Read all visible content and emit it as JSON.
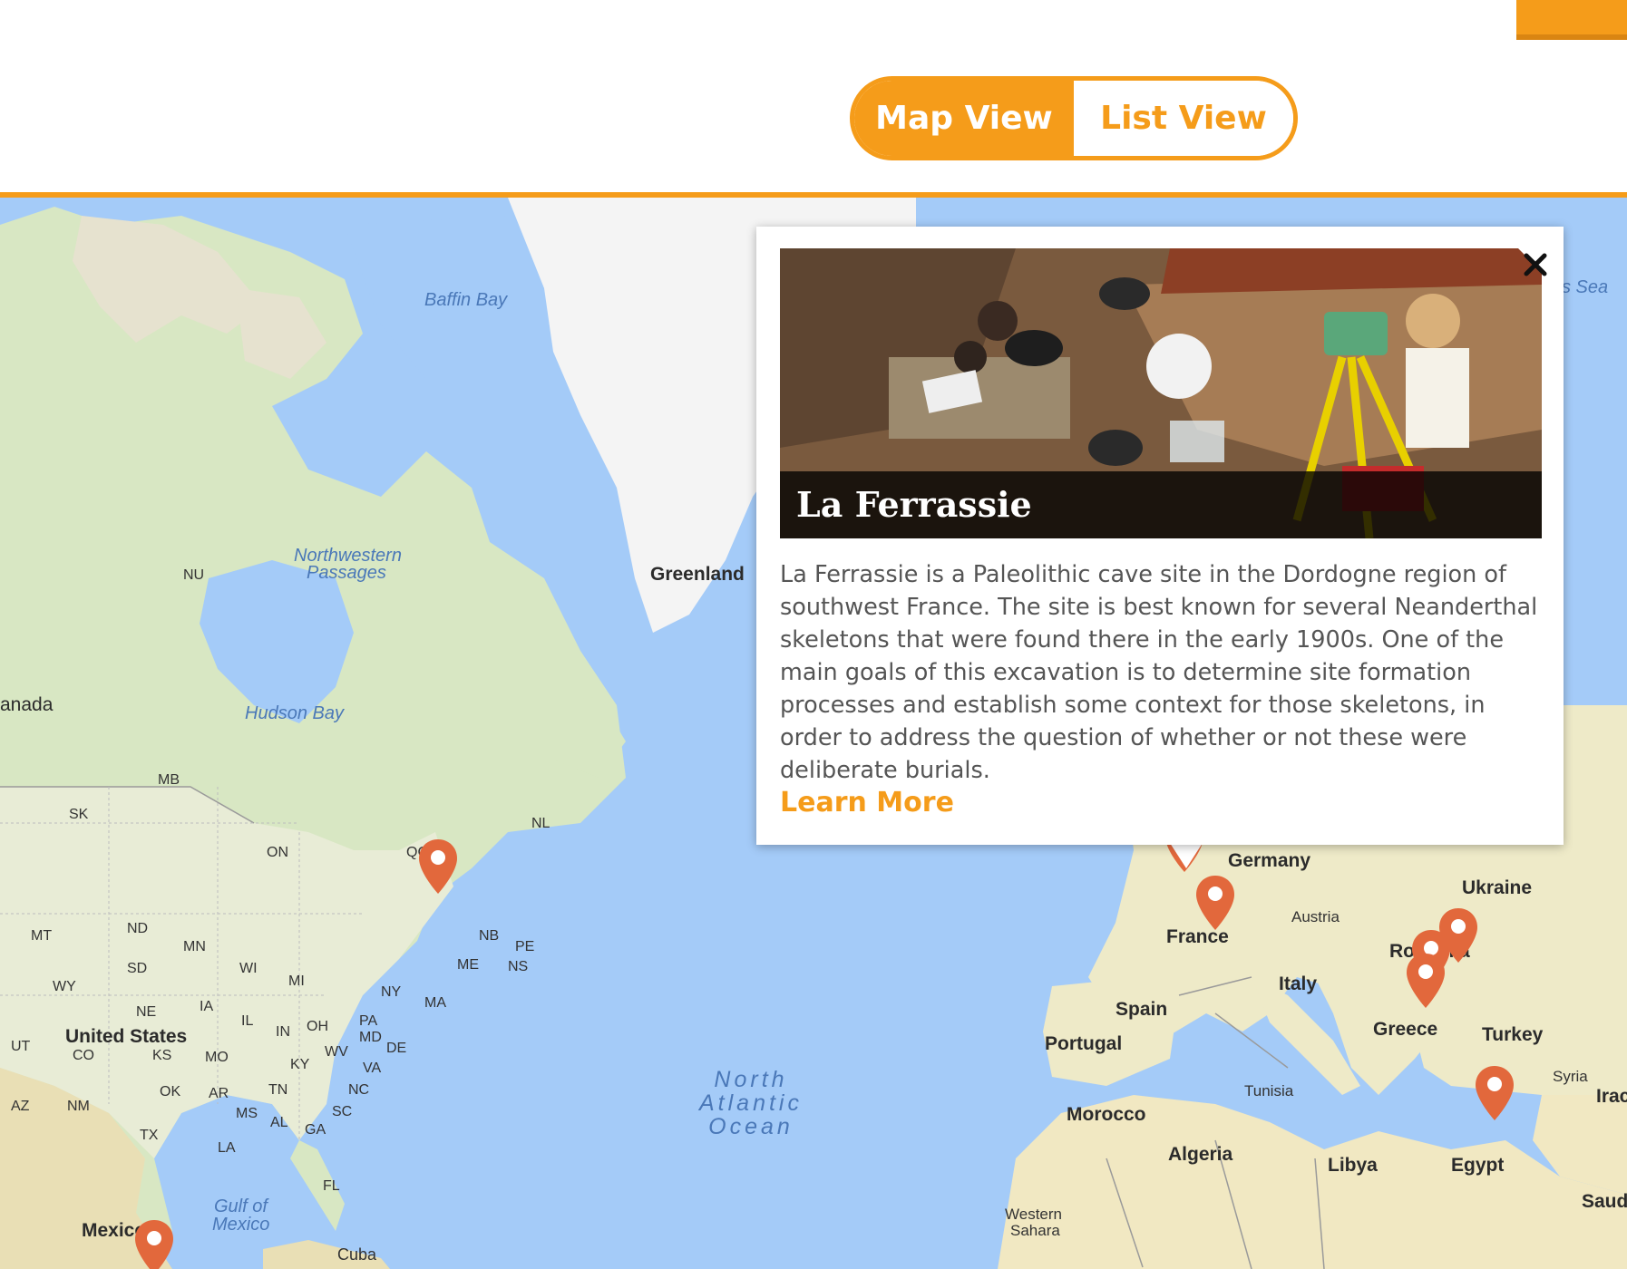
{
  "header": {
    "toggle": {
      "map_view_label": "Map View",
      "list_view_label": "List View",
      "selected": "Map View"
    },
    "accent_color": "#f59c1a"
  },
  "map": {
    "labels": {
      "baffin_bay": "Baffin Bay",
      "northwestern_passages_1": "Northwestern",
      "northwestern_passages_2": "Passages",
      "hudson_bay": "Hudson Bay",
      "greenland": "Greenland",
      "canada": "anada",
      "nu": "NU",
      "mb": "MB",
      "sk": "SK",
      "on": "ON",
      "qc": "QC",
      "nl": "NL",
      "nb": "NB",
      "pe": "PE",
      "ns": "NS",
      "me": "ME",
      "ma": "MA",
      "ny": "NY",
      "mt": "MT",
      "nd": "ND",
      "mn": "MN",
      "wi": "WI",
      "mi": "MI",
      "sd": "SD",
      "wy": "WY",
      "ne": "NE",
      "ia": "IA",
      "il": "IL",
      "in": "IN",
      "oh": "OH",
      "pa": "PA",
      "md": "MD",
      "de": "DE",
      "ut": "UT",
      "co": "CO",
      "ks": "KS",
      "mo": "MO",
      "ky": "KY",
      "wv": "WV",
      "va": "VA",
      "az": "AZ",
      "nm": "NM",
      "ok": "OK",
      "ar": "AR",
      "tn": "TN",
      "nc": "NC",
      "ms": "MS",
      "al": "AL",
      "ga": "GA",
      "sc": "SC",
      "tx": "TX",
      "la": "LA",
      "fl": "FL",
      "united_states": "United States",
      "gulf_of_mexico_1": "Gulf of",
      "gulf_of_mexico_2": "Mexico",
      "mexico": "Mexico",
      "cuba": "Cuba",
      "north_atlantic_1": "North",
      "north_atlantic_2": "Atlantic",
      "north_atlantic_3": "Ocean",
      "germany": "Germany",
      "ukraine": "Ukraine",
      "austria": "Austria",
      "france": "France",
      "romania": "Romania",
      "italy": "Italy",
      "spain": "Spain",
      "portugal": "Portugal",
      "greece": "Greece",
      "turkey": "Turkey",
      "syria": "Syria",
      "iraq": "Irac",
      "tunisia": "Tunisia",
      "morocco": "Morocco",
      "algeria": "Algeria",
      "libya": "Libya",
      "egypt": "Egypt",
      "western_sahara_1": "Western",
      "western_sahara_2": "Sahara",
      "saudi": "Saud",
      "sea": "s Sea"
    },
    "marker_color": "#e2683c"
  },
  "popup": {
    "title": "La Ferrassie",
    "description": "La Ferrassie is a Paleolithic cave site in the Dordogne region of southwest France. The site is best known for several Neanderthal skeletons that were found there in the early 1900s. One of the main goals of this excavation is to determine site formation processes and establish some context for those skeletons, in order to address the question of whether or not these were deliberate burials.",
    "learn_more_label": "Learn More",
    "close_icon": "close-icon"
  }
}
